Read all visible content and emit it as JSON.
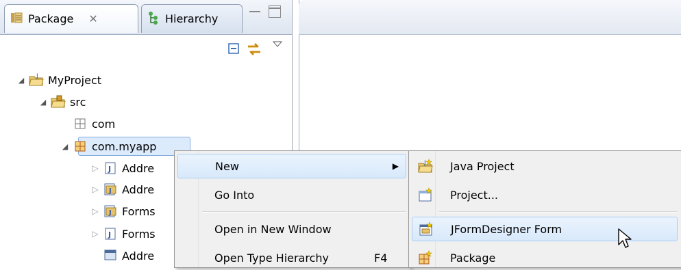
{
  "view": {
    "tabs": [
      {
        "label": "Package",
        "close": "✕",
        "icon": "package-explorer-icon"
      },
      {
        "label": "Hierarchy",
        "icon": "hierarchy-icon"
      }
    ],
    "toolbar": {
      "icons": [
        "collapse-all-icon",
        "link-with-editor-icon",
        "view-menu-icon"
      ]
    }
  },
  "tree": [
    {
      "label": "MyProject",
      "icon": "java-project-icon",
      "expanded": true
    },
    {
      "label": "src",
      "icon": "source-folder-icon",
      "expanded": true
    },
    {
      "label": "com",
      "icon": "empty-package-icon"
    },
    {
      "label": "com.myapp",
      "icon": "package-icon",
      "expanded": true,
      "selected": true
    },
    {
      "label": "Addre",
      "icon": "java-file-icon"
    },
    {
      "label": "Addre",
      "icon": "form-file-icon"
    },
    {
      "label": "Forms",
      "icon": "form-file-icon"
    },
    {
      "label": "Forms",
      "icon": "java-file-icon"
    },
    {
      "label": "Addre",
      "icon": "form-file-icon"
    }
  ],
  "context_menu": {
    "items": [
      {
        "label": "New",
        "has_submenu": true
      },
      {
        "label": "Go Into"
      },
      {
        "label": "Open in New Window"
      },
      {
        "label": "Open Type Hierarchy",
        "shortcut": "F4"
      }
    ]
  },
  "submenu": {
    "items": [
      {
        "label": "Java Project",
        "icon": "new-java-project-icon"
      },
      {
        "label": "Project...",
        "icon": "new-project-icon"
      },
      {
        "label": "JFormDesigner Form",
        "icon": "jformdesigner-form-icon",
        "highlighted": true
      },
      {
        "label": "Package",
        "icon": "new-package-icon"
      }
    ]
  },
  "colors": {
    "selection": "#dcebfc",
    "menu_highlight_border": "#a8cdf5",
    "tab_border": "#8f9db3"
  }
}
